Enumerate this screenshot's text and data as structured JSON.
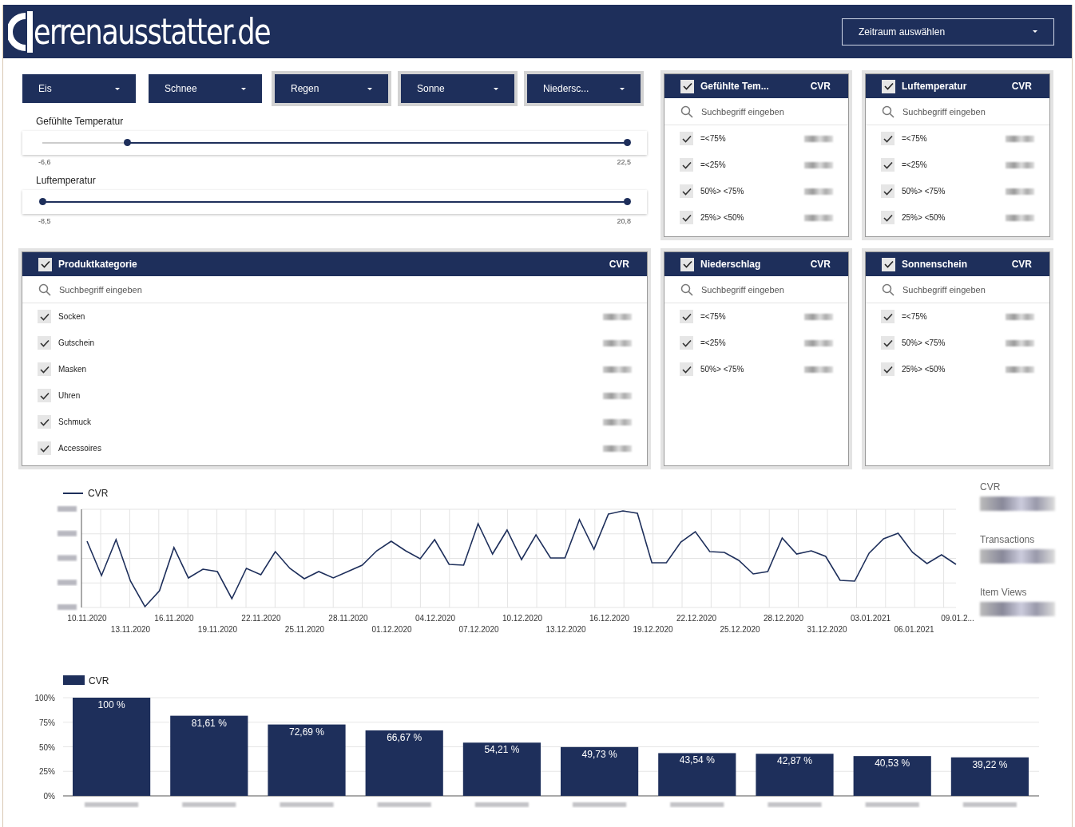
{
  "header": {
    "logo": "errenausstatter.de",
    "period_select": {
      "label": "Zeitraum auswählen"
    }
  },
  "dropdowns": [
    {
      "label": "Eis",
      "highlighted": false
    },
    {
      "label": "Schnee",
      "highlighted": false
    },
    {
      "label": "Regen",
      "highlighted": true
    },
    {
      "label": "Sonne",
      "highlighted": true
    },
    {
      "label": "Niedersc...",
      "highlighted": true
    }
  ],
  "sliders": [
    {
      "label": "Gefühlte Temperatur",
      "min": "-6,6",
      "max": "22,5",
      "thumbs": [
        {
          "level": 0.145
        },
        {
          "level": 1
        }
      ]
    },
    {
      "label": "Luftemperatur",
      "min": "-8,5",
      "max": "20,8",
      "thumbs": [
        {
          "level": 0
        },
        {
          "level": 1
        }
      ]
    }
  ],
  "filter_panels": [
    {
      "title": "Gefühlte Tem...",
      "metric": "CVR",
      "checked": true,
      "search_placeholder": "Suchbegriff eingeben",
      "items": [
        {
          "label": "=<75%",
          "checked": true
        },
        {
          "label": "=<25%",
          "checked": true
        },
        {
          "label": "50%> <75%",
          "checked": true
        },
        {
          "label": "25%> <50%",
          "checked": true
        }
      ]
    },
    {
      "title": "Luftemperatur",
      "metric": "CVR",
      "checked": true,
      "search_placeholder": "Suchbegriff eingeben",
      "items": [
        {
          "label": "=<75%",
          "checked": true
        },
        {
          "label": "=<25%",
          "checked": true
        },
        {
          "label": "50%> <75%",
          "checked": true
        },
        {
          "label": "25%> <50%",
          "checked": true
        }
      ]
    },
    {
      "title": "Produktkategorie",
      "metric": "CVR",
      "checked": true,
      "search_placeholder": "Suchbegriff eingeben",
      "items": [
        {
          "label": "Socken",
          "checked": true
        },
        {
          "label": "Gutschein",
          "checked": true
        },
        {
          "label": "Masken",
          "checked": true
        },
        {
          "label": "Uhren",
          "checked": true
        },
        {
          "label": "Schmuck",
          "checked": true
        },
        {
          "label": "Accessoires",
          "checked": true
        }
      ]
    },
    {
      "title": "Niederschlag",
      "metric": "CVR",
      "checked": true,
      "search_placeholder": "Suchbegriff eingeben",
      "items": [
        {
          "label": "=<75%",
          "checked": true
        },
        {
          "label": "=<25%",
          "checked": true
        },
        {
          "label": "50%> <75%",
          "checked": true
        }
      ]
    },
    {
      "title": "Sonnenschein",
      "metric": "CVR",
      "checked": true,
      "search_placeholder": "Suchbegriff eingeben",
      "items": [
        {
          "label": "=<75%",
          "checked": true
        },
        {
          "label": "50%> <75%",
          "checked": true
        },
        {
          "label": "25%> <50%",
          "checked": true
        }
      ]
    }
  ],
  "line_chart": {
    "legend": "CVR",
    "x_labels": [
      "10.11.2020",
      "13.11.2020",
      "16.11.2020",
      "19.11.2020",
      "22.11.2020",
      "25.11.2020",
      "28.11.2020",
      "01.12.2020",
      "04.12.2020",
      "07.12.2020",
      "10.12.2020",
      "13.12.2020",
      "16.12.2020",
      "19.12.2020",
      "22.12.2020",
      "25.12.2020",
      "28.12.2020",
      "31.12.2020",
      "03.01.2021",
      "06.01.2021",
      "09.01.2..."
    ]
  },
  "scorecards": [
    {
      "label": "CVR"
    },
    {
      "label": "Transactions"
    },
    {
      "label": "Item Views"
    }
  ],
  "bar_chart": {
    "chart_data": {
      "type": "bar",
      "series": [
        {
          "name": "CVR",
          "color": "#1e2f5b",
          "values": [
            100,
            81.61,
            72.69,
            66.67,
            54.21,
            49.73,
            43.54,
            42.87,
            40.53,
            39.22
          ]
        }
      ],
      "ylim": [
        0,
        100
      ],
      "yticks": [
        {
          "value": 0,
          "label": "0%"
        },
        {
          "value": 25,
          "label": "25%"
        },
        {
          "value": 50,
          "label": "50%"
        },
        {
          "value": 75,
          "label": "75%"
        },
        {
          "value": 100,
          "label": "100%"
        }
      ],
      "grid": true,
      "value_labels": [
        "100 %",
        "81,61 %",
        "72,69 %",
        "66,67 %",
        "54,21 %",
        "49,73 %",
        "43,54 %",
        "42,87 %",
        "40,53 %",
        "39,22 %"
      ]
    }
  }
}
